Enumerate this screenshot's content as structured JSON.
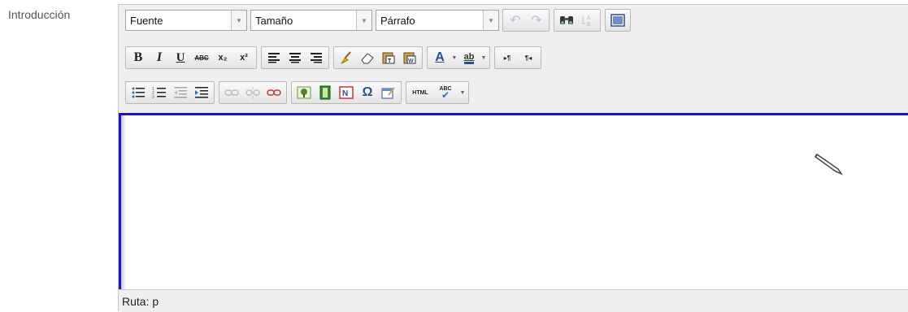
{
  "field": {
    "label": "Introducción"
  },
  "toolbar": {
    "font_select": "Fuente",
    "size_select": "Tamaño",
    "format_select": "Párrafo",
    "bold": "B",
    "italic": "I",
    "underline": "U",
    "strikethrough": "ABC",
    "subscript": "x₂",
    "superscript": "x²",
    "text_color": "A",
    "highlight": "ab",
    "ltr": "▸¶",
    "rtl": "¶◂",
    "special_char": "Ω",
    "html": "HTML",
    "spell": "ABC"
  },
  "status": {
    "path": "Ruta: p"
  },
  "colors": {
    "focus_border": "#1414d6",
    "toolbar_bg": "#efefef"
  }
}
